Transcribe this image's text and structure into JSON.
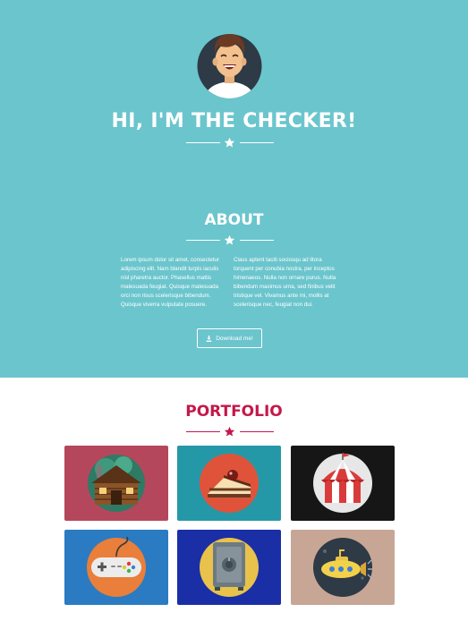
{
  "hero": {
    "title": "HI, I'M THE CHECKER!",
    "background": "#6bc5cd",
    "avatar_icon": "smiling-man-avatar-icon"
  },
  "about": {
    "title": "ABOUT",
    "left_text": "Lorem ipsum dolor sit amet, consectetur adipiscing elit. Nam blandit turpis iaculis nisl pharetra auctor. Phasellus mattis malesuada feugiat. Quisque malesuada orci non risus scelerisque bibendum. Quisque viverra vulputate posuere.",
    "right_text": "Class aptent taciti sociosqu ad litora torquent per conubia nostra, per inceptos himenaeos. Nulla non ornare purus. Nulla bibendum maximus urna, sed finibus velit tristique vel. Vivamus ante mi, mollis at scelerisque nec, feugiat non dui.",
    "download_label": "Download me!",
    "download_icon": "download-icon"
  },
  "portfolio": {
    "title": "PORTFOLIO",
    "accent": "#c5184a",
    "items": [
      {
        "icon": "log-cabin-icon",
        "background": "#b5475c"
      },
      {
        "icon": "cake-slice-icon",
        "background": "#2598a7"
      },
      {
        "icon": "circus-tent-icon",
        "background": "#161616"
      },
      {
        "icon": "game-controller-icon",
        "background": "#2a7bc2"
      },
      {
        "icon": "safe-icon",
        "background": "#1a2ea6"
      },
      {
        "icon": "submarine-icon",
        "background": "#c8a695"
      }
    ]
  }
}
